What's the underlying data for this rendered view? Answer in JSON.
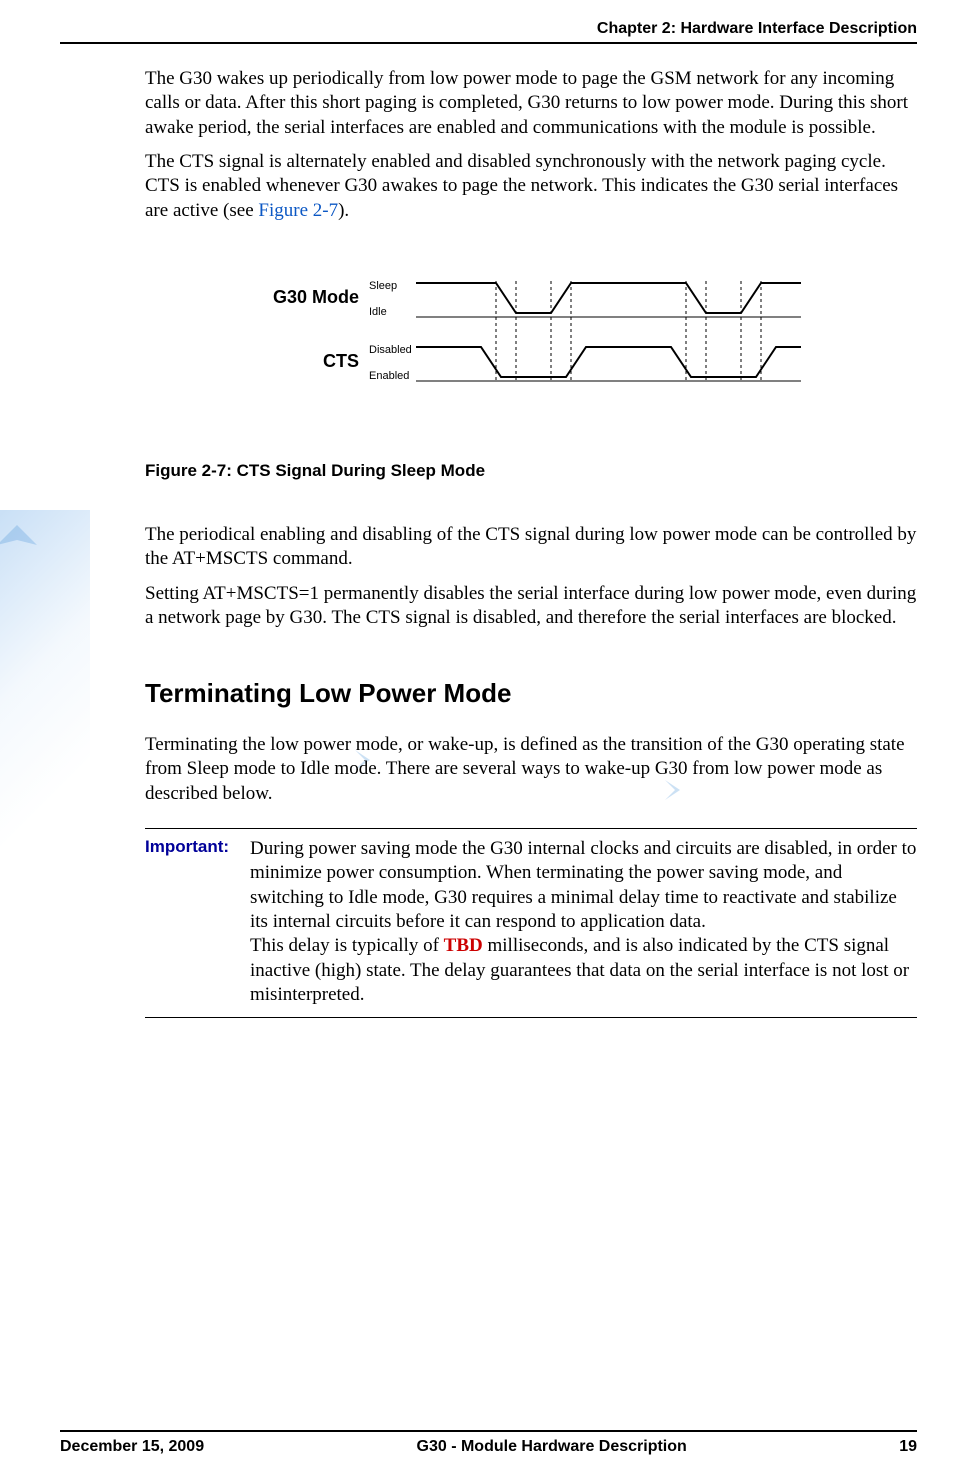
{
  "header": {
    "chapter": "Chapter 2:  Hardware Interface Description"
  },
  "body": {
    "p1": "The G30 wakes up periodically from low power mode to page the GSM network for any incoming calls or data. After this short paging is completed, G30 returns to low power mode. During this short awake period, the serial interfaces are enabled and communications with the module is possible.",
    "p2a": "The CTS signal is alternately enabled and disabled synchronously with the network paging cycle. CTS is enabled whenever G30 awakes to page the network. This indicates the G30 serial interfaces are active (see ",
    "p2_link": "Figure 2-7",
    "p2b": ").",
    "fig": {
      "caption": "Figure 2-7: CTS Signal During Sleep Mode",
      "labels": {
        "mode": "G30 Mode",
        "cts": "CTS",
        "sleep": "Sleep",
        "idle": "Idle",
        "disabled": "Disabled",
        "enabled": "Enabled"
      }
    },
    "p3": "The periodical enabling and disabling of the CTS signal during low power mode can be controlled by the AT+MSCTS command.",
    "p4": "Setting AT+MSCTS=1 permanently disables the serial interface during low power mode, even during a network page by G30. The CTS signal is disabled, and therefore the serial interfaces are blocked.",
    "section": "Terminating Low Power Mode",
    "p5": "Terminating the low power mode, or wake-up, is defined as the transition of the G30 operating state from Sleep mode to Idle mode. There are several ways to wake-up G30 from low power mode as described below.",
    "important": {
      "label": "Important:",
      "text1": "During power saving mode the G30 internal clocks and circuits are disabled, in order to minimize power consumption. When terminating the power saving mode, and switching to Idle mode, G30 requires a minimal delay time to reactivate and stabilize its internal circuits before it can respond to application data.",
      "text2a": "This delay is typically of  ",
      "tbd": "TBD",
      "text2b": " milliseconds, and is also indicated by the CTS signal inactive (high) state. The delay guarantees that data on the serial interface is not lost or misinterpreted."
    }
  },
  "footer": {
    "date": "December 15, 2009",
    "title": "G30 - Module Hardware Description",
    "page": "19"
  }
}
